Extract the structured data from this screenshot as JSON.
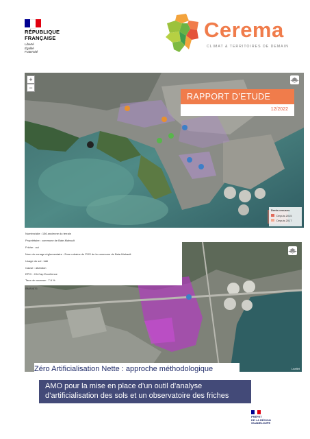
{
  "header": {
    "republique": {
      "line1": "RÉPUBLIQUE",
      "line2": "FRANÇAISE",
      "motto": [
        "Liberté",
        "Égalité",
        "Fraternité"
      ],
      "flag_colors": [
        "#000091",
        "#ffffff",
        "#e1000f"
      ]
    },
    "cerema": {
      "name": "Cerema",
      "tagline": "CLIMAT & TERRITOIRES DE DEMAIN",
      "brand_color": "#f07c4b"
    }
  },
  "report": {
    "label": "RAPPORT D’ETUDE",
    "date": "12/2022"
  },
  "map": {
    "zoom_in": "+",
    "zoom_out": "−",
    "legend": {
      "title": "Dents creuses",
      "items": [
        {
          "label": "Depuis 2015",
          "color": "#e06a5a"
        },
        {
          "label": "Depuis 2017",
          "color": "#f2a98f"
        }
      ]
    },
    "attribution": "Leaflet"
  },
  "info_popup": {
    "lines": [
      "Numéro/site : 156 ancienne du terrain",
      "Propriétaire : commune de Baie-Mahault",
      "Friche : oui",
      "Nom du zonage réglementaire : Zone urbaine du POS de la commune de Baie-Mahault",
      "Usage du sol : bâti",
      "Cause : abandon",
      "EPCI : CA Cap Excellence",
      "Taux de vacance : 7.6 %"
    ],
    "footer": "BMA9876"
  },
  "titles": {
    "main": "Zéro Artificialisation Nette : approche méthodologique",
    "sub_line1": "AMO pour la mise en place d’un outil d’analyse",
    "sub_line2": "d’artificialisation des sols et un observatoire des friches"
  },
  "footer": {
    "region": [
      "PRÉFET",
      "DE LA RÉGION",
      "GUADELOUPE"
    ]
  }
}
